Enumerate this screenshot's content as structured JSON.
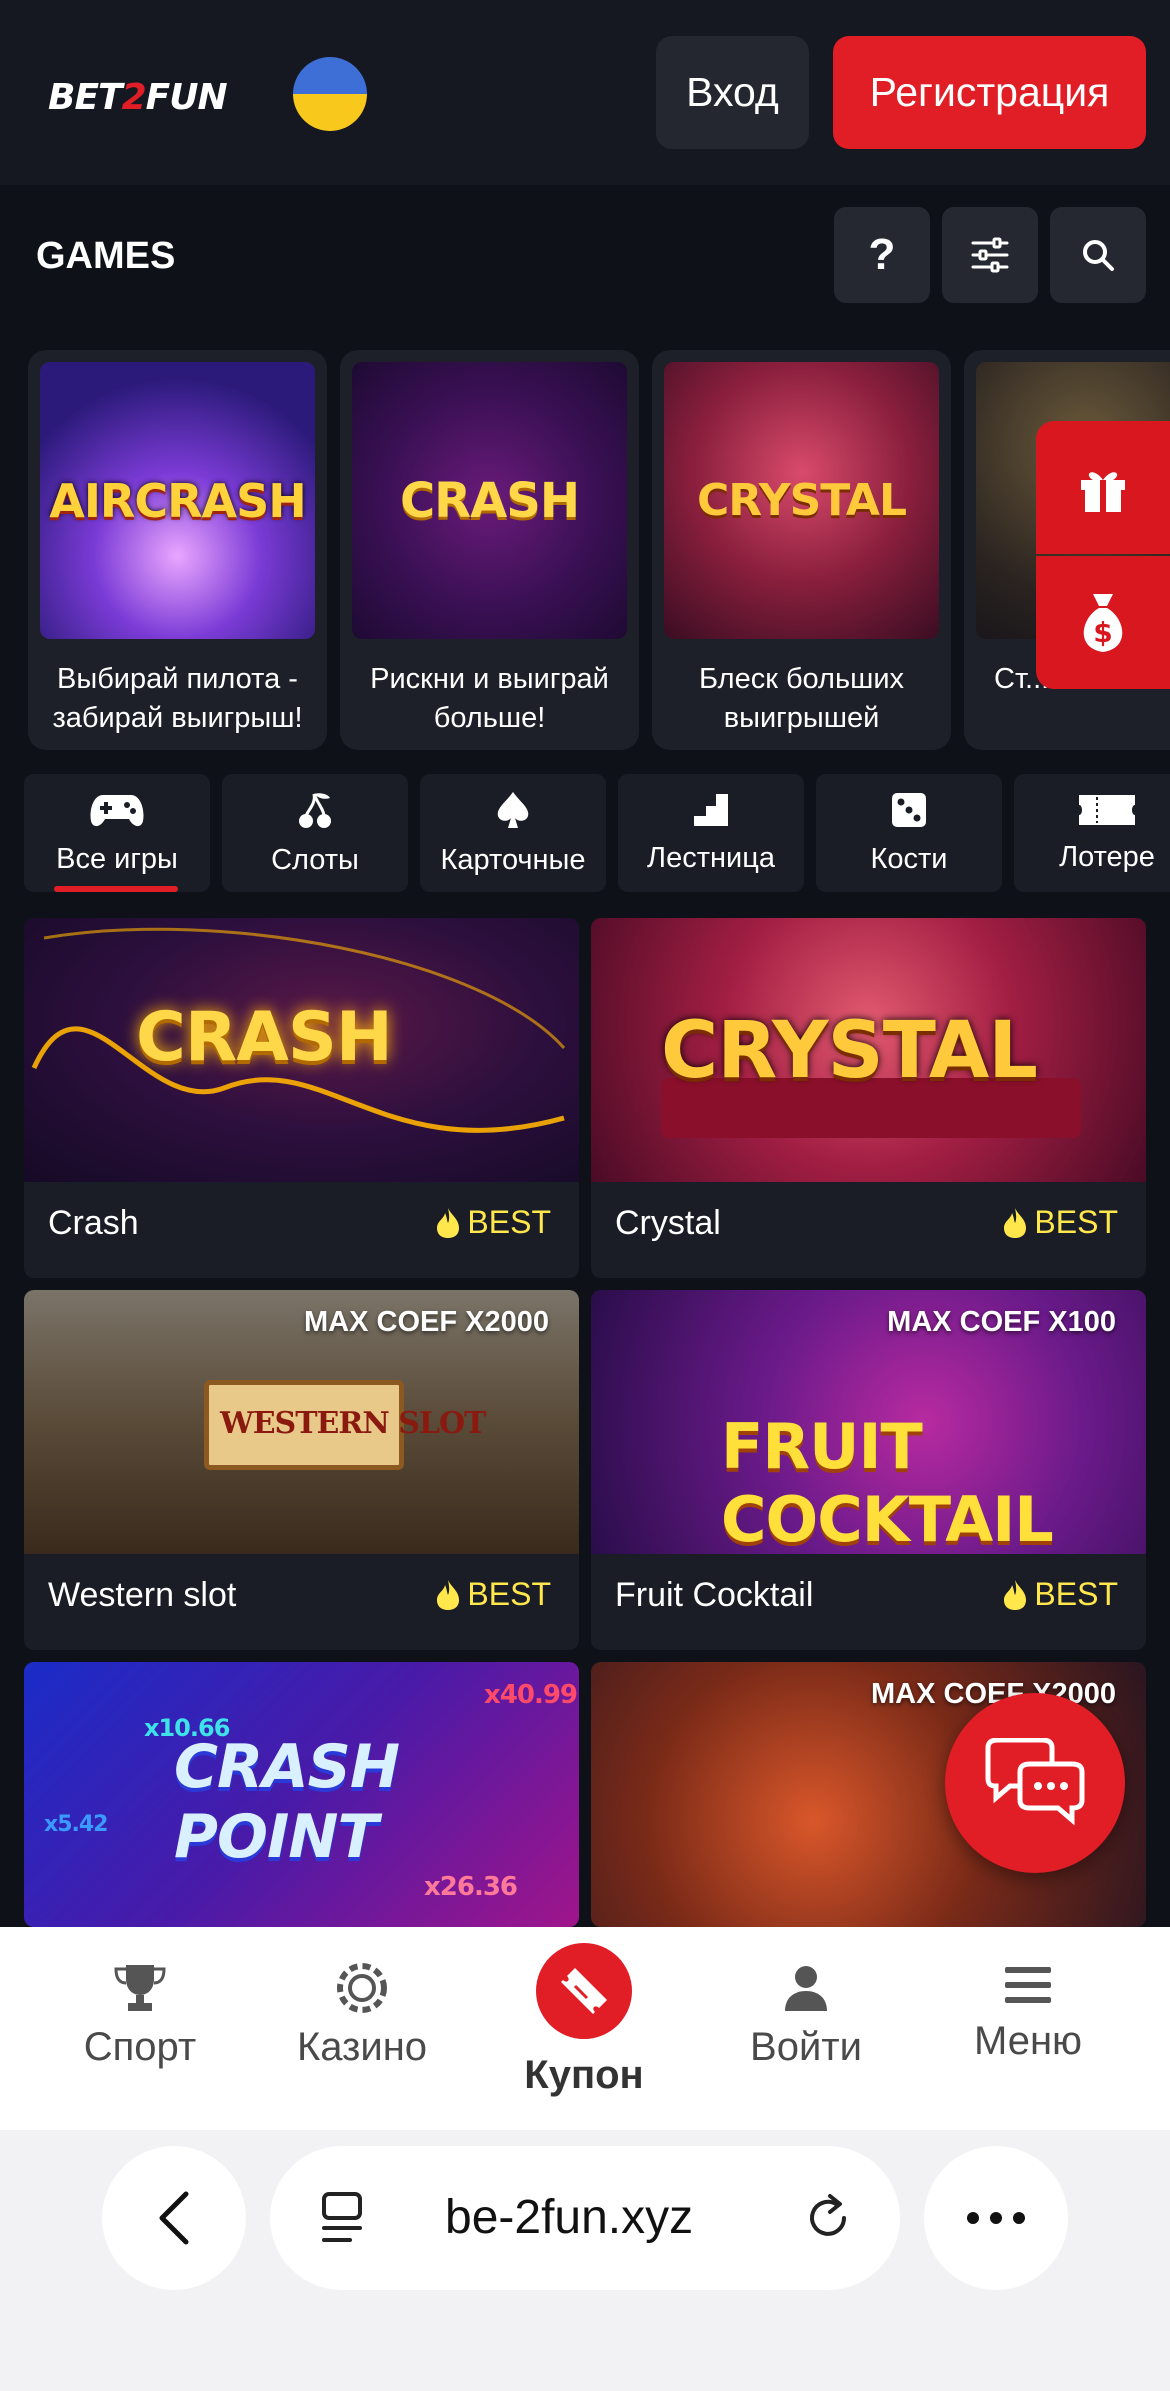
{
  "header": {
    "logo": "BET2FUN",
    "login_label": "Вход",
    "register_label": "Регистрация"
  },
  "games_bar": {
    "title": "GAMES",
    "help_icon": "question-icon",
    "filter_icon": "sliders-icon",
    "search_icon": "search-icon"
  },
  "promos": [
    {
      "art": "AIRCRASH",
      "caption": "Выбирай пилота - забирай выигрыш!"
    },
    {
      "art": "CRASH",
      "caption": "Рискни и выиграй больше!"
    },
    {
      "art": "CRYSTAL",
      "caption": "Блеск больших выигрышей"
    },
    {
      "art": "",
      "caption": "Ст... косте..."
    }
  ],
  "side_buttons": [
    "gift-icon",
    "money-bag-icon"
  ],
  "categories": [
    {
      "label": "Все игры",
      "icon": "gamepad-icon",
      "active": true
    },
    {
      "label": "Слоты",
      "icon": "cherry-icon"
    },
    {
      "label": "Карточные",
      "icon": "spade-icon"
    },
    {
      "label": "Лестница",
      "icon": "stairs-icon"
    },
    {
      "label": "Кости",
      "icon": "dice-icon"
    },
    {
      "label": "Лотере",
      "icon": "ticket-icon"
    }
  ],
  "games": [
    {
      "name": "Crash",
      "tag": "BEST",
      "art": "CRASH",
      "coef": ""
    },
    {
      "name": "Crystal",
      "tag": "BEST",
      "art": "CRYSTAL",
      "coef": ""
    },
    {
      "name": "Western slot",
      "tag": "BEST",
      "art": "WESTERN SLOT",
      "coef": "MAX COEF X2000"
    },
    {
      "name": "Fruit Cocktail",
      "tag": "BEST",
      "art": "FRUIT COCKTAIL",
      "coef": "MAX COEF X100"
    },
    {
      "name": "",
      "tag": "",
      "art": "CRASH POINT",
      "coef": "",
      "mult_a": "x10.66",
      "mult_b": "x40.99",
      "mult_c": "x5.42",
      "mult_d": "x26.36"
    },
    {
      "name": "",
      "tag": "",
      "art": "",
      "coef": "MAX COEF X2000"
    }
  ],
  "bottom_nav": {
    "sport": "Спорт",
    "casino": "Казино",
    "coupon": "Купон",
    "login": "Войти",
    "menu": "Меню"
  },
  "browser": {
    "url": "be-2fun.xyz"
  },
  "colors": {
    "accent_red": "#e11d26",
    "background": "#0f1119",
    "card": "#1b1d26",
    "best_yellow": "#ffe74c"
  }
}
